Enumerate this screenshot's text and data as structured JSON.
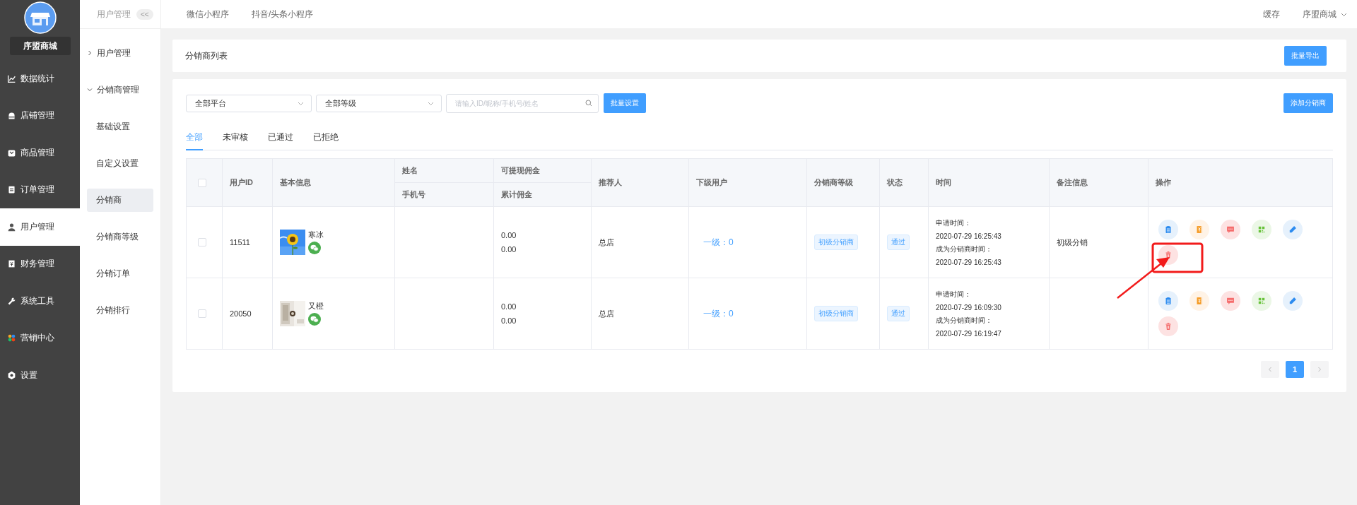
{
  "sidebar": {
    "shop_name": "序盟商城",
    "items": [
      {
        "label": "数据统计",
        "kind": "chart",
        "selected": false
      },
      {
        "label": "店铺管理",
        "kind": "shop",
        "selected": false
      },
      {
        "label": "商品管理",
        "kind": "goods",
        "selected": false
      },
      {
        "label": "订单管理",
        "kind": "order",
        "selected": false
      },
      {
        "label": "用户管理",
        "kind": "user",
        "selected": true
      },
      {
        "label": "财务管理",
        "kind": "finance",
        "selected": false
      },
      {
        "label": "系统工具",
        "kind": "tool",
        "selected": false
      },
      {
        "label": "营销中心",
        "kind": "marketing",
        "selected": false
      },
      {
        "label": "设置",
        "kind": "settings",
        "selected": false
      }
    ]
  },
  "submenu": {
    "title": "用户管理",
    "collapse": "<<",
    "groups": [
      {
        "label": "用户管理",
        "expanded": false
      },
      {
        "label": "分销商管理",
        "expanded": true,
        "children": [
          {
            "label": "基础设置",
            "selected": false
          },
          {
            "label": "自定义设置",
            "selected": false
          },
          {
            "label": "分销商",
            "selected": true
          },
          {
            "label": "分销商等级",
            "selected": false
          },
          {
            "label": "分销订单",
            "selected": false
          },
          {
            "label": "分销排行",
            "selected": false
          }
        ]
      }
    ]
  },
  "topbar": {
    "tabs": [
      "微信小程序",
      "抖音/头条小程序"
    ],
    "cache": "缓存",
    "account": "序盟商城"
  },
  "header_card": {
    "title": "分销商列表",
    "export_button": "批量导出"
  },
  "filters": {
    "platform": "全部平台",
    "level": "全部等级",
    "search_placeholder": "请输入ID/昵称/手机号/姓名",
    "batch_button": "批量设置",
    "add_button": "添加分销商"
  },
  "tabs": [
    {
      "label": "全部",
      "selected": true
    },
    {
      "label": "未审核",
      "selected": false
    },
    {
      "label": "已通过",
      "selected": false
    },
    {
      "label": "已拒绝",
      "selected": false
    }
  ],
  "table": {
    "select_all_checked": false,
    "columns": {
      "id": "用户ID",
      "info": "基本信息",
      "name": "姓名",
      "phone": "手机号",
      "withdrawable": "可提现佣金",
      "total": "累计佣金",
      "referrer": "推荐人",
      "subordinates": "下级用户",
      "level": "分销商等级",
      "status": "状态",
      "time": "时间",
      "note": "备注信息",
      "actions": "操作"
    },
    "rows": [
      {
        "checked": false,
        "id": "11511",
        "nickname": "寒冰",
        "withdrawable": "0.00",
        "total": "0.00",
        "referrer": "总店",
        "subordinates": "一级：0",
        "level_tag": "初级分销商",
        "status_tag": "通过",
        "apply_label": "申请时间：",
        "apply_time": "2020-07-29 16:25:43",
        "become_label": "成为分销商时间：",
        "become_time": "2020-07-29 16:25:43",
        "note": "初级分销"
      },
      {
        "checked": false,
        "id": "20050",
        "nickname": "又橙",
        "withdrawable": "0.00",
        "total": "0.00",
        "referrer": "总店",
        "subordinates": "一级：0",
        "level_tag": "初级分销商",
        "status_tag": "通过",
        "apply_label": "申请时间：",
        "apply_time": "2020-07-29 16:09:30",
        "become_label": "成为分销商时间：",
        "become_time": "2020-07-29 16:19:47"
      }
    ]
  },
  "annotation": {
    "kind": "frame_with_arrow"
  },
  "pagination": {
    "pages": [
      {
        "label": "1",
        "selected": true
      }
    ]
  }
}
